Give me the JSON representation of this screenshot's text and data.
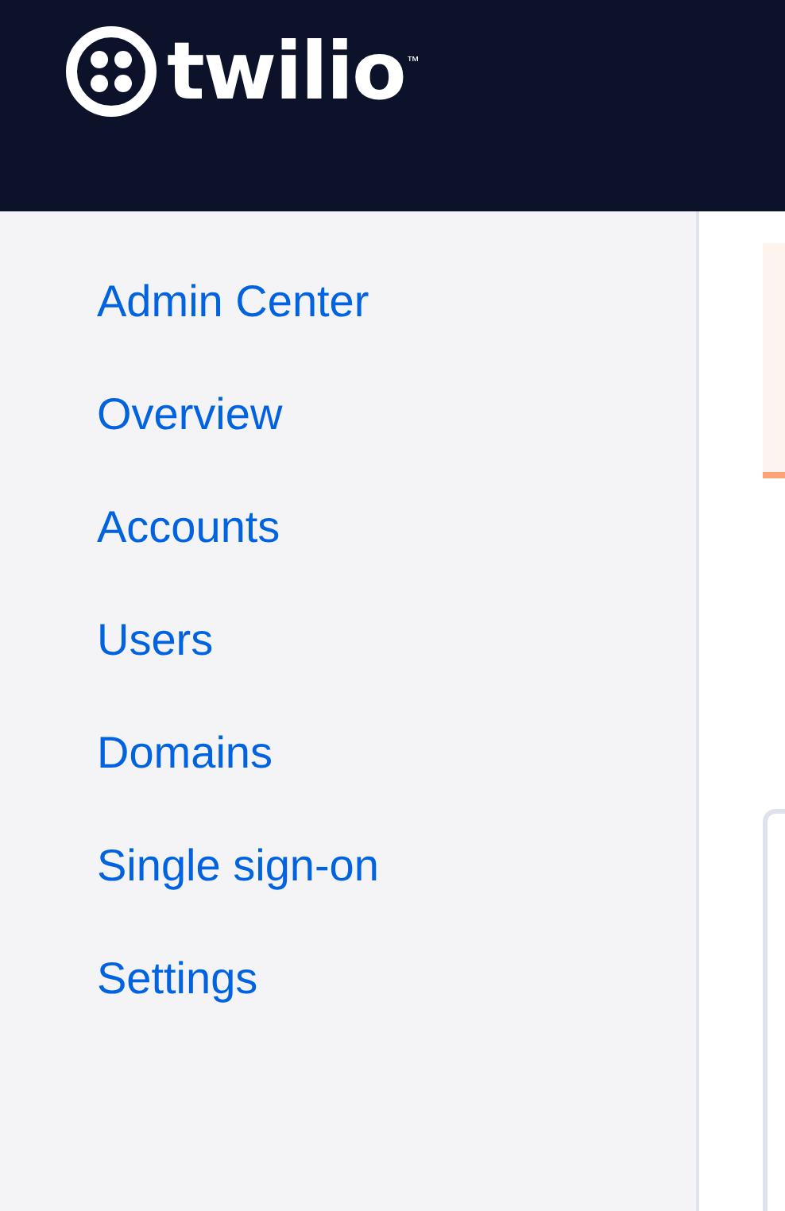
{
  "header": {
    "logo_text": "twilio",
    "trademark": "™"
  },
  "sidebar": {
    "items": [
      {
        "label": "Admin Center"
      },
      {
        "label": "Overview"
      },
      {
        "label": "Accounts"
      },
      {
        "label": "Users"
      },
      {
        "label": "Domains"
      },
      {
        "label": "Single sign-on"
      },
      {
        "label": "Settings"
      }
    ]
  }
}
